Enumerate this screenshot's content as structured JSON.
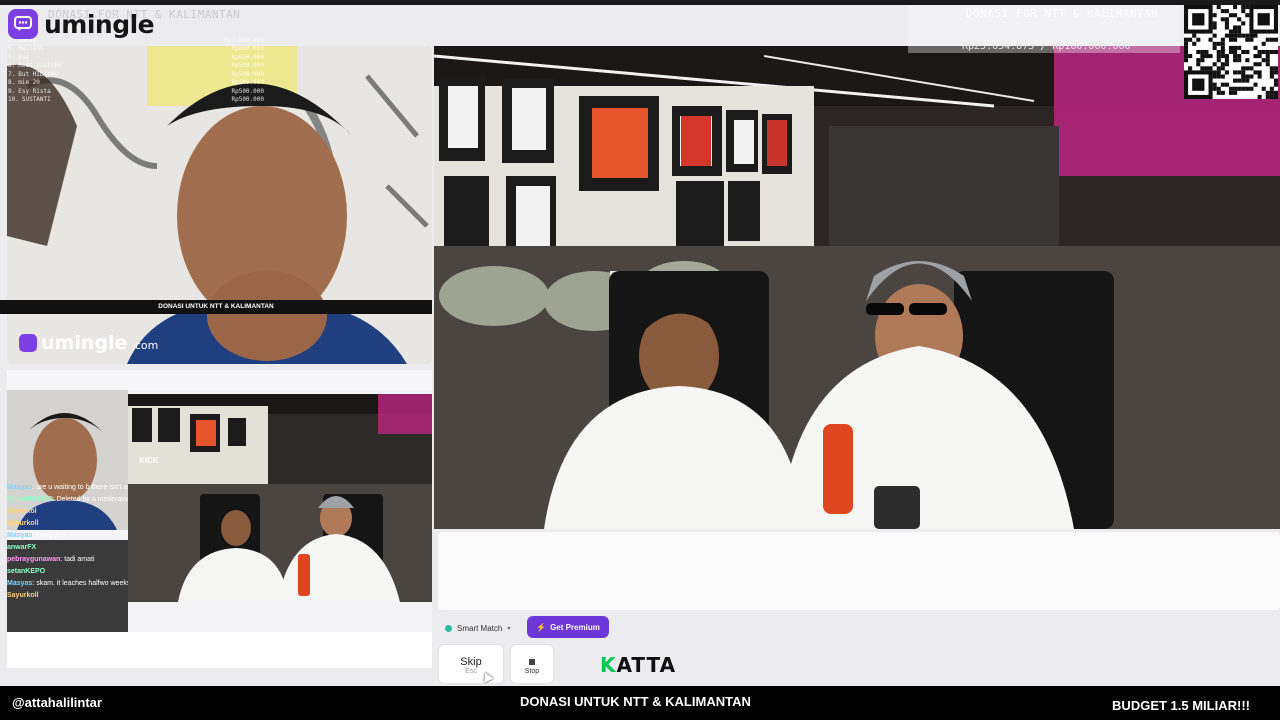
{
  "app": {
    "brand": "umingle",
    "watermark_brand": "umingle",
    "watermark_domain": ".com"
  },
  "overlay": {
    "title_left": "DONASI FOR NTT & KALIMANTAN",
    "title_right": "DONASI FOR NTT & KALIMANTAN",
    "progress_text": "Rp25.654.873 / Rp100.000.000",
    "progress_value": 0.2565,
    "leaderboard": [
      {
        "rank": "1.",
        "name": "RANDO",
        "amount": ""
      },
      {
        "rank": "2.",
        "name": "ZAMAN",
        "amount": "Rp1.000.000"
      },
      {
        "rank": "5.",
        "name": "Mellins",
        "amount": "Rp800.000"
      },
      {
        "rank": "5.",
        "name": "Esy",
        "amount": "Rp600.000"
      },
      {
        "rank": "6.",
        "name": "Reet ristiko",
        "amount": "Rp500.000"
      },
      {
        "rank": "7.",
        "name": "But HIDAYAH",
        "amount": "Rp500.000"
      },
      {
        "rank": "8.",
        "name": "mie 20",
        "amount": "Rp500.000"
      },
      {
        "rank": "9.",
        "name": "Esy Rista",
        "amount": "Rp500.000"
      },
      {
        "rank": "10.",
        "name": "SUSTANTI",
        "amount": "Rp500.000"
      }
    ]
  },
  "embed": {
    "kick_tag": "KICK",
    "chat": [
      {
        "user": "Masyas",
        "text": "are u waiting to b there isn't any kick",
        "color": "b"
      },
      {
        "user": "Gibra0626828",
        "text": "Deleted by a moderator",
        "color": "g"
      },
      {
        "user": "Sayurkol",
        "text": "",
        "color": "y"
      },
      {
        "user": "Sayurkoll",
        "text": "",
        "color": "y"
      },
      {
        "user": "Masyas",
        "text": "funny live",
        "color": "b"
      },
      {
        "user": "anwarFX",
        "text": "",
        "color": "g"
      },
      {
        "user": "pebraygunawan",
        "text": "tadi amati",
        "color": "p"
      },
      {
        "user": "setanKEPO",
        "text": "",
        "color": "g"
      },
      {
        "user": "Masyas",
        "text": "skam. it leaches halfwo weeks kan kick",
        "color": "b"
      },
      {
        "user": "Sayurkoll",
        "text": "",
        "color": "y"
      }
    ],
    "footer_text": "DONASI UNTUK NTT & KALIMANTAN"
  },
  "controls": {
    "smart_match": "Smart Match",
    "get_premium": "Get Premium",
    "skip_label": "Skip",
    "skip_key": "Esc",
    "stop_label": "Stop",
    "sponsor_k": "K",
    "sponsor_rest": "ATTA"
  },
  "footer": {
    "handle": "@attahalilintar",
    "center": "DONASI UNTUK NTT & KALIMANTAN",
    "right": "BUDGET 1.5 MILIAR!!!"
  },
  "colors": {
    "brand_purple": "#7b3fe4",
    "premium_purple": "#6d36d8",
    "sponsor_green": "#00c853",
    "footer_bg": "#000000"
  }
}
